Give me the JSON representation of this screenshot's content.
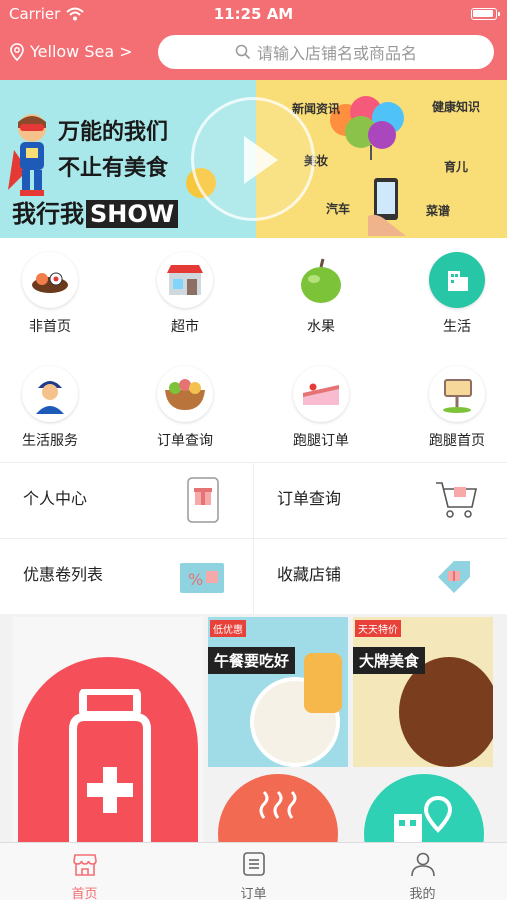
{
  "status": {
    "carrier": "Carrier",
    "time": "11:25 AM"
  },
  "location": {
    "label": "Yellow Sea >"
  },
  "search": {
    "placeholder": "请输入店铺名或商品名"
  },
  "banner": {
    "line1": "万能的我们",
    "line2": "不止有美食",
    "line3a": "我行我",
    "line3b": "SHOW",
    "labels": [
      "新闻资讯",
      "健康知识",
      "美妆",
      "育儿",
      "汽车",
      "菜谱"
    ]
  },
  "categories": [
    {
      "label": "非首页",
      "icon": "sushi-icon"
    },
    {
      "label": "超市",
      "icon": "store-icon"
    },
    {
      "label": "水果",
      "icon": "apple-icon"
    },
    {
      "label": "生活",
      "icon": "building-icon"
    },
    {
      "label": "生活服务",
      "icon": "worker-icon"
    },
    {
      "label": "订单查询",
      "icon": "salad-bowl-icon"
    },
    {
      "label": "跑腿订单",
      "icon": "cake-icon"
    },
    {
      "label": "跑腿首页",
      "icon": "signboard-icon"
    }
  ],
  "quick": [
    {
      "label": "个人中心",
      "icon": "phone-gift-icon"
    },
    {
      "label": "订单查询",
      "icon": "cart-gift-icon"
    },
    {
      "label": "优惠卷列表",
      "icon": "coupon-icon"
    },
    {
      "label": "收藏店铺",
      "icon": "gift-tag-icon"
    }
  ],
  "promo": {
    "card1_tag": "低优惠",
    "card1_title": "午餐要吃好",
    "card2_tag": "天天特价",
    "card2_title": "大牌美食"
  },
  "tabs": [
    {
      "label": "首页",
      "icon": "home-store-icon"
    },
    {
      "label": "订单",
      "icon": "order-list-icon"
    },
    {
      "label": "我的",
      "icon": "user-icon"
    }
  ],
  "colors": {
    "accent": "#f46f73",
    "banner_left": "#a8e8ea",
    "banner_right": "#f9dd76"
  }
}
